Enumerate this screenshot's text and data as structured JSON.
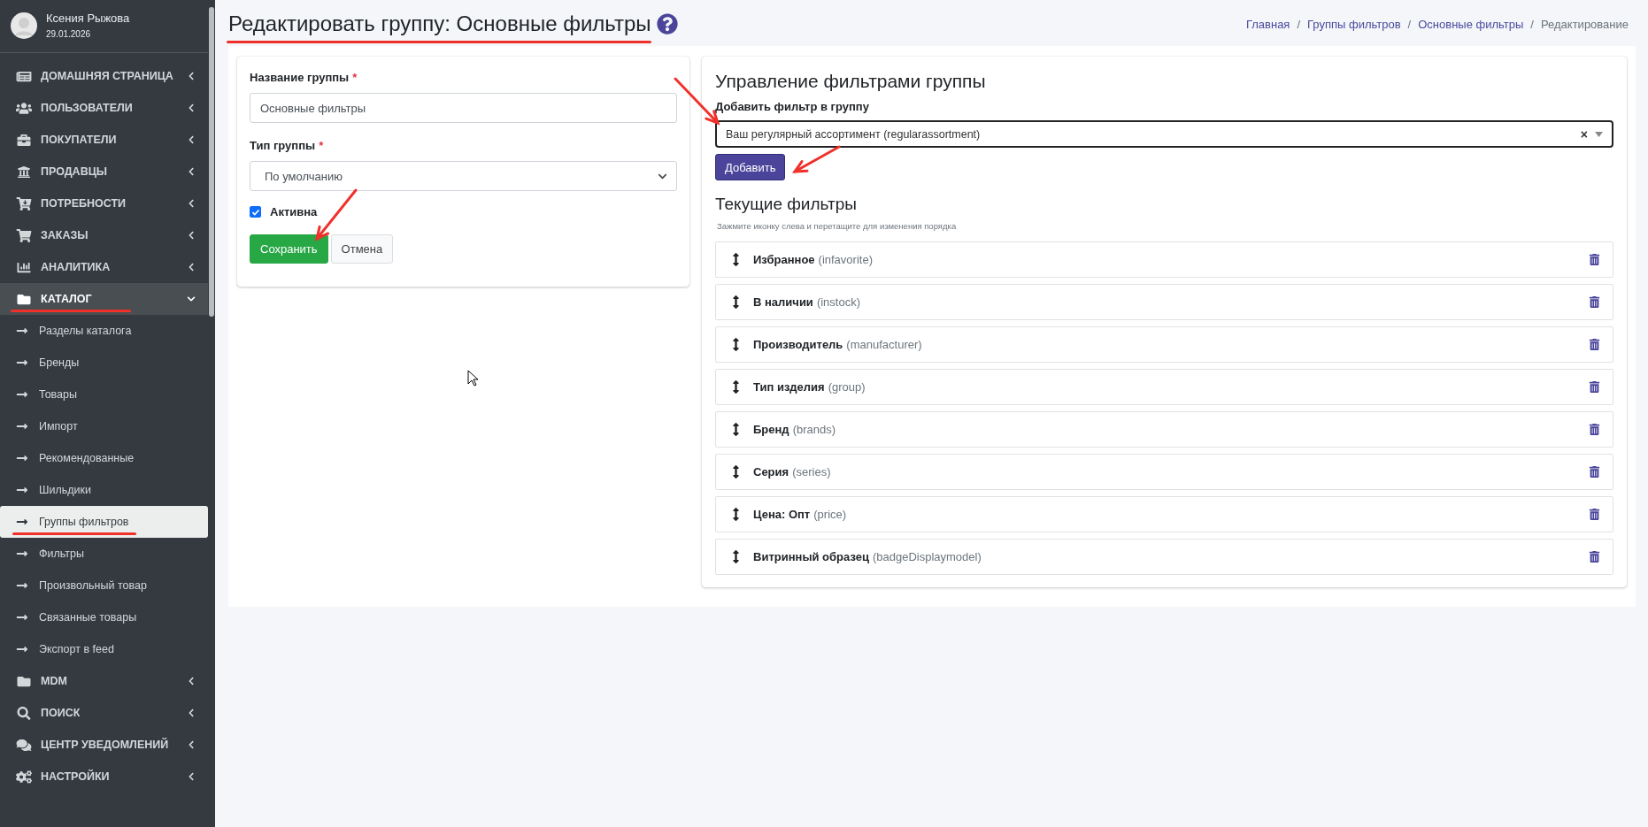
{
  "user": {
    "name": "Ксения Рыжова",
    "date": "29.01.2026"
  },
  "sidebar": {
    "items": [
      {
        "label": "ДОМАШНЯЯ СТРАНИЦА",
        "expanded": false,
        "underlined": false
      },
      {
        "label": "ПОЛЬЗОВАТЕЛИ",
        "expanded": false,
        "underlined": false
      },
      {
        "label": "ПОКУПАТЕЛИ",
        "expanded": false,
        "underlined": false
      },
      {
        "label": "ПРОДАВЦЫ",
        "expanded": false,
        "underlined": false
      },
      {
        "label": "ПОТРЕБНОСТИ",
        "expanded": false,
        "underlined": false
      },
      {
        "label": "ЗАКАЗЫ",
        "expanded": false,
        "underlined": false
      },
      {
        "label": "АНАЛИТИКА",
        "expanded": false,
        "underlined": false
      },
      {
        "label": "КАТАЛОГ",
        "expanded": true,
        "underlined": true,
        "children": [
          {
            "label": "Разделы каталога",
            "selected": false,
            "underlined": false
          },
          {
            "label": "Бренды",
            "selected": false,
            "underlined": false
          },
          {
            "label": "Товары",
            "selected": false,
            "underlined": false
          },
          {
            "label": "Импорт",
            "selected": false,
            "underlined": false
          },
          {
            "label": "Рекомендованные",
            "selected": false,
            "underlined": false
          },
          {
            "label": "Шильдики",
            "selected": false,
            "underlined": false
          },
          {
            "label": "Группы фильтров",
            "selected": true,
            "underlined": true
          },
          {
            "label": "Фильтры",
            "selected": false,
            "underlined": false
          },
          {
            "label": "Произвольный товар",
            "selected": false,
            "underlined": false
          },
          {
            "label": "Связанные товары",
            "selected": false,
            "underlined": false
          },
          {
            "label": "Экспорт в feed",
            "selected": false,
            "underlined": false
          }
        ]
      },
      {
        "label": "MDM",
        "expanded": false,
        "underlined": false
      },
      {
        "label": "ПОИСК",
        "expanded": false,
        "underlined": false
      },
      {
        "label": "ЦЕНТР УВЕДОМЛЕНИЙ",
        "expanded": false,
        "underlined": false
      },
      {
        "label": "НАСТРОЙКИ",
        "expanded": false,
        "underlined": false
      }
    ]
  },
  "page_title": {
    "text": "Редактировать группу: Основные фильтры",
    "underlined": true
  },
  "breadcrumbs": [
    {
      "label": "Главная",
      "selected": false
    },
    {
      "label": "Группы фильтров",
      "selected": false
    },
    {
      "label": "Основные фильтры",
      "selected": false
    },
    {
      "label": "Редактирование",
      "selected": true
    }
  ],
  "breadcrumb_separator": "/",
  "group_form": {
    "fields": [
      {
        "kind": "text",
        "label": "Название группы",
        "required_mark": "*",
        "value": "Основные фильтры"
      },
      {
        "kind": "select",
        "label": "Тип группы",
        "required_mark": "*",
        "value": "По умолчанию"
      }
    ],
    "active": {
      "label": "Активна",
      "checked": true
    },
    "buttons": [
      {
        "label": "Сохранить",
        "kind": "primary"
      },
      {
        "label": "Отмена",
        "kind": "secondary"
      }
    ]
  },
  "filters_panel": {
    "title": "Управление фильтрами группы",
    "add_label": "Добавить фильтр в группу",
    "add_value": "Ваш регулярный ассортимент (regularassortment)",
    "clear": "×",
    "add_button": "Добавить",
    "current_title": "Текущие фильтры",
    "hint": "Зажмите иконку слева и перетащите для изменения порядка",
    "filters": [
      {
        "name": "Избранное",
        "code": "(infavorite)"
      },
      {
        "name": "В наличии",
        "code": "(instock)"
      },
      {
        "name": "Производитель",
        "code": "(manufacturer)"
      },
      {
        "name": "Тип изделия",
        "code": "(group)"
      },
      {
        "name": "Бренд",
        "code": "(brands)"
      },
      {
        "name": "Серия",
        "code": "(series)"
      },
      {
        "name": "Цена: Опт",
        "code": "(price)"
      },
      {
        "name": "Витринный образец",
        "code": "(badgeDisplaymodel)"
      }
    ]
  }
}
